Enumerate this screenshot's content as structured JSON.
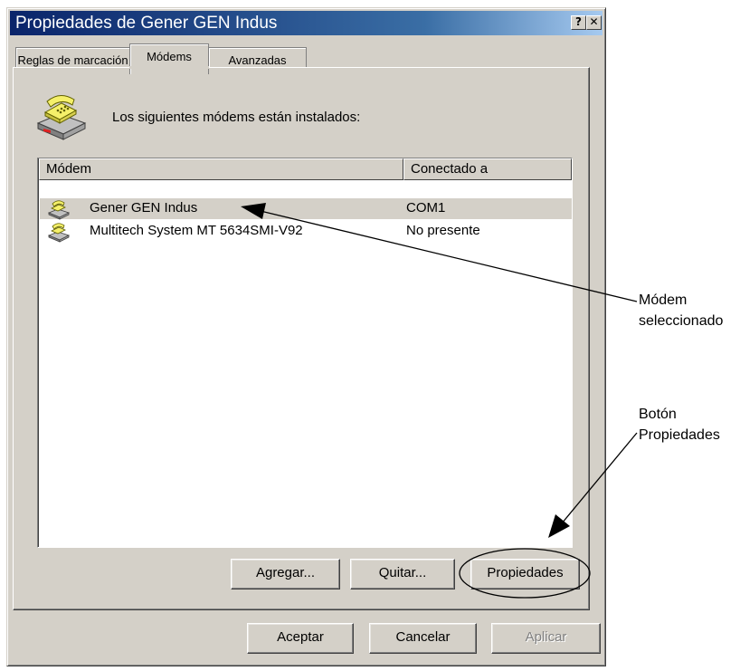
{
  "window": {
    "title": "Propiedades de Gener GEN Indus",
    "help_button": "?",
    "close_button": "✕"
  },
  "tabs": [
    {
      "label": "Reglas de marcación",
      "active": false
    },
    {
      "label": "Módems",
      "active": true
    },
    {
      "label": "Avanzadas",
      "active": false
    }
  ],
  "info": {
    "icon": "phone-modem-icon",
    "text": "Los siguientes módems están instalados:"
  },
  "list": {
    "columns": [
      "Módem",
      "Conectado a"
    ],
    "rows": [
      {
        "name": "Gener GEN Indus",
        "port": "COM1",
        "icon": "modem-icon",
        "selected": true
      },
      {
        "name": "Multitech System MT 5634SMI-V92",
        "port": "No presente",
        "icon": "modem-icon",
        "selected": false
      }
    ]
  },
  "list_buttons": {
    "add": "Agregar...",
    "remove": "Quitar...",
    "properties": "Propiedades"
  },
  "dialog_buttons": {
    "ok": "Aceptar",
    "cancel": "Cancelar",
    "apply": "Aplicar",
    "apply_disabled": true
  },
  "annotations": {
    "selected_modem": [
      "Módem",
      "seleccionado"
    ],
    "properties_button": [
      "Botón",
      "Propiedades"
    ]
  },
  "colors": {
    "titlebar": "#0a246a",
    "face": "#d4d0c8",
    "selection": "#d4d0c8"
  }
}
